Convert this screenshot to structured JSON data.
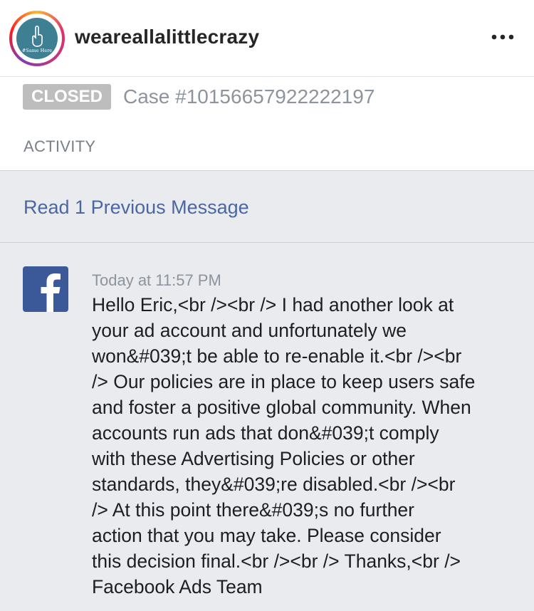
{
  "header": {
    "username": "weareallalittlecrazy",
    "avatar_text": "#Same Here"
  },
  "case": {
    "status": "CLOSED",
    "number": "Case #10156657922222197",
    "section_label": "ACTIVITY"
  },
  "thread": {
    "previous_link": "Read 1 Previous Message"
  },
  "message": {
    "timestamp": "Today at 11:57 PM",
    "lines": [
      "Hello Eric,<br /><br /> I had another look at",
      "your ad account and unfortunately we",
      "won&#039;t be able to re-enable it.<br /><br",
      "/> Our policies are in place to keep users safe",
      "and foster a positive global community. When",
      "accounts run ads that don&#039;t comply",
      "with these Advertising Policies or other",
      "standards, they&#039;re disabled.<br /><br",
      "/> At this point there&#039;s no further",
      "action that you may take. Please consider",
      "this decision final.<br /><br /> Thanks,<br />",
      "Facebook Ads Team"
    ]
  },
  "icons": {
    "more": "more-horizontal-icon",
    "sender": "facebook-logo-icon"
  },
  "colors": {
    "link": "#4b67a1",
    "badge": "#bdbdbd",
    "facebook_blue": "#3b5998",
    "background": "#e9ebee"
  }
}
